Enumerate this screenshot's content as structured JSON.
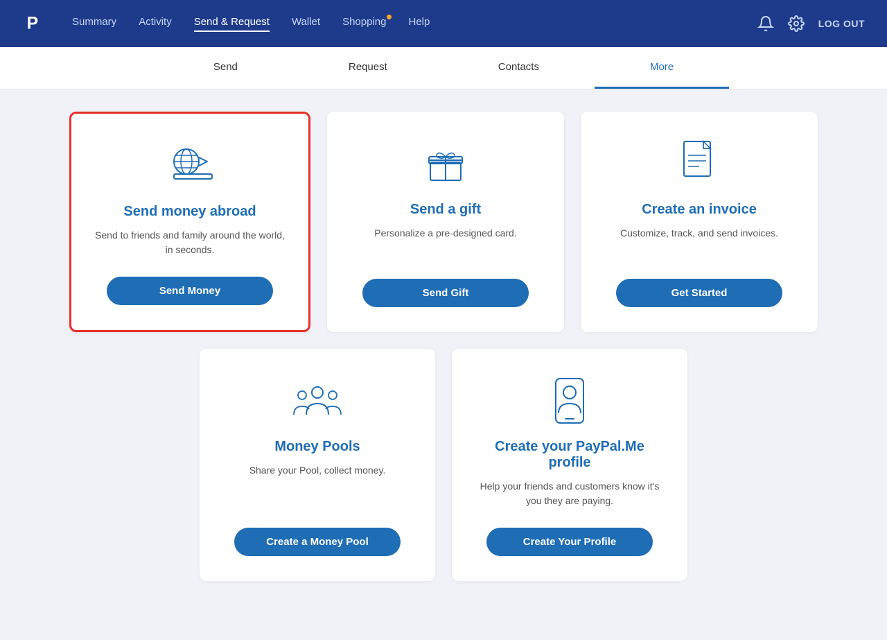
{
  "nav": {
    "links": [
      {
        "label": "Summary",
        "active": false
      },
      {
        "label": "Activity",
        "active": false
      },
      {
        "label": "Send & Request",
        "active": true
      },
      {
        "label": "Wallet",
        "active": false
      },
      {
        "label": "Shopping",
        "active": false,
        "dot": true
      },
      {
        "label": "Help",
        "active": false
      }
    ],
    "logout_label": "LOG OUT"
  },
  "sub_nav": {
    "links": [
      {
        "label": "Send",
        "active": false
      },
      {
        "label": "Request",
        "active": false
      },
      {
        "label": "Contacts",
        "active": false
      },
      {
        "label": "More",
        "active": true
      }
    ]
  },
  "cards": {
    "row1": [
      {
        "id": "send-money-abroad",
        "title": "Send money abroad",
        "desc": "Send to friends and family around the world, in seconds.",
        "btn_label": "Send Money",
        "highlighted": true
      },
      {
        "id": "send-gift",
        "title": "Send a gift",
        "desc": "Personalize a pre-designed card.",
        "btn_label": "Send Gift",
        "highlighted": false
      },
      {
        "id": "create-invoice",
        "title": "Create an invoice",
        "desc": "Customize, track, and send invoices.",
        "btn_label": "Get Started",
        "highlighted": false
      }
    ],
    "row2": [
      {
        "id": "money-pools",
        "title": "Money Pools",
        "desc": "Share your Pool, collect money.",
        "btn_label": "Create a Money Pool"
      },
      {
        "id": "paypalme",
        "title": "Create your PayPal.Me profile",
        "desc": "Help your friends and customers know it's you they are paying.",
        "btn_label": "Create Your Profile"
      }
    ]
  }
}
